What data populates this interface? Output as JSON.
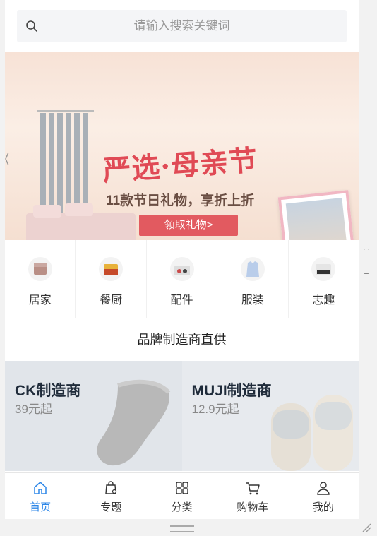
{
  "search": {
    "placeholder": "请输入搜索关键词"
  },
  "banner": {
    "title": "严选·母亲节",
    "subtitle": "11款节日礼物，享折上折",
    "cta": "领取礼物>",
    "active_dot": 1
  },
  "categories": [
    {
      "label": "居家",
      "icon": "home-goods-icon"
    },
    {
      "label": "餐厨",
      "icon": "kitchen-icon"
    },
    {
      "label": "配件",
      "icon": "accessory-icon"
    },
    {
      "label": "服装",
      "icon": "clothing-icon"
    },
    {
      "label": "志趣",
      "icon": "hobby-icon"
    }
  ],
  "section_title": "品牌制造商直供",
  "brands": [
    {
      "name": "CK制造商",
      "price": "39元起"
    },
    {
      "name": "MUJI制造商",
      "price": "12.9元起"
    }
  ],
  "tabs": [
    {
      "label": "首页",
      "icon": "home-icon",
      "active": true
    },
    {
      "label": "专题",
      "icon": "topic-bag-icon"
    },
    {
      "label": "分类",
      "icon": "category-grid-icon"
    },
    {
      "label": "购物车",
      "icon": "cart-icon"
    },
    {
      "label": "我的",
      "icon": "user-icon"
    }
  ],
  "colors": {
    "accent": "#2d87e8",
    "banner_red": "#e25a60"
  }
}
